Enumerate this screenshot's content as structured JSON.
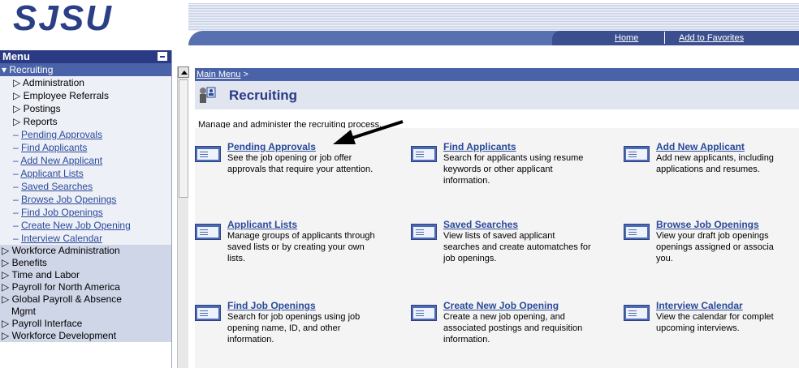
{
  "header": {
    "logo": "SJSU",
    "home_link": "Home",
    "favorites_link": "Add to Favorites"
  },
  "menu": {
    "title": "Menu",
    "active": "Recruiting",
    "sub_groups": [
      "Administration",
      "Employee Referrals",
      "Postings",
      "Reports"
    ],
    "sub_links": [
      "Pending Approvals",
      "Find Applicants",
      "Add New Applicant",
      "Applicant Lists",
      "Saved Searches",
      "Browse Job Openings",
      "Find Job Openings",
      "Create New Job Opening",
      "Interview Calendar"
    ],
    "top_groups": [
      "Workforce Administration",
      "Benefits",
      "Time and Labor",
      "Payroll for North America",
      "Global Payroll & Absence",
      "Payroll Interface",
      "Workforce Development"
    ],
    "global_payroll_wrap": "Mgmt"
  },
  "main": {
    "breadcrumb": "Main Menu",
    "breadcrumb_sep": ">",
    "title": "Recruiting",
    "description": "Manage and administer the recruiting process.",
    "cells": [
      {
        "title": "Pending Approvals",
        "lines": [
          "See the job opening or job offer",
          "approvals that require your attention."
        ]
      },
      {
        "title": "Find Applicants",
        "lines": [
          "Search for applicants using resume",
          "keywords or other applicant",
          "information."
        ]
      },
      {
        "title": "Add New Applicant",
        "lines": [
          "Add new applicants, including",
          "applications and resumes."
        ]
      },
      {
        "title": "Applicant Lists",
        "lines": [
          "Manage groups of applicants through",
          "saved lists or by creating your own",
          "lists."
        ]
      },
      {
        "title": "Saved Searches",
        "lines": [
          "View lists of saved applicant",
          "searches and create automatches for",
          "job openings."
        ]
      },
      {
        "title": "Browse Job Openings",
        "lines": [
          "View your draft job openings",
          "openings assigned or associa",
          "you."
        ]
      },
      {
        "title": "Find Job Openings",
        "lines": [
          "Search for job openings using job",
          "opening name, ID, and other",
          "information."
        ]
      },
      {
        "title": "Create New Job Opening",
        "lines": [
          "Create a new job opening, and",
          "associated postings and requisition",
          "information."
        ]
      },
      {
        "title": "Interview Calendar",
        "lines": [
          "View the calendar for complet",
          "upcoming interviews."
        ]
      }
    ]
  },
  "colors": {
    "brand": "#2a3f86",
    "banner": "#5771b0",
    "link": "#2a4a9a",
    "active_menu": "#4a62a8"
  }
}
